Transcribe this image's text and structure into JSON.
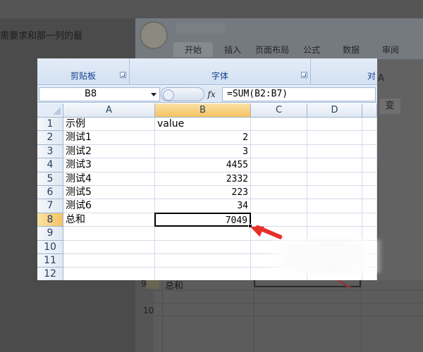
{
  "background": {
    "instruction_text": "需要求和那一列的最",
    "ribbon_tabs": [
      "开始",
      "插入",
      "页面布局",
      "公式",
      "数据",
      "审阅"
    ],
    "right_panel_font_label": "A",
    "right_panel_bold_label": "变",
    "row_9_label": "9",
    "row_10_label": "10",
    "total_label": "总和"
  },
  "ribbon": {
    "groups": [
      {
        "label": "剪贴板"
      },
      {
        "label": "字体"
      },
      {
        "label": "对"
      }
    ]
  },
  "formula_bar": {
    "name_box": "B8",
    "fx_label": "fx",
    "formula": "=SUM(B2:B7)"
  },
  "sheet": {
    "columns": [
      "A",
      "B",
      "C",
      "D"
    ],
    "selected_column": "B",
    "rows": [
      {
        "num": "1",
        "a": "示例",
        "b": "value"
      },
      {
        "num": "2",
        "a": "测试1",
        "b": "2"
      },
      {
        "num": "3",
        "a": "测试2",
        "b": "3"
      },
      {
        "num": "4",
        "a": "测试3",
        "b": "4455"
      },
      {
        "num": "5",
        "a": "测试4",
        "b": "2332"
      },
      {
        "num": "6",
        "a": "测试5",
        "b": "223"
      },
      {
        "num": "7",
        "a": "测试6",
        "b": "34"
      },
      {
        "num": "8",
        "a": "总和",
        "b": "7049"
      },
      {
        "num": "9",
        "a": "",
        "b": ""
      },
      {
        "num": "10",
        "a": "",
        "b": ""
      },
      {
        "num": "11",
        "a": "",
        "b": ""
      },
      {
        "num": "12",
        "a": "",
        "b": ""
      }
    ],
    "selected_row": "8",
    "active_cell": "B8"
  },
  "colors": {
    "header_selected": "#f4c262",
    "ribbon_text": "#15428b",
    "arrow": "#e8302a"
  }
}
